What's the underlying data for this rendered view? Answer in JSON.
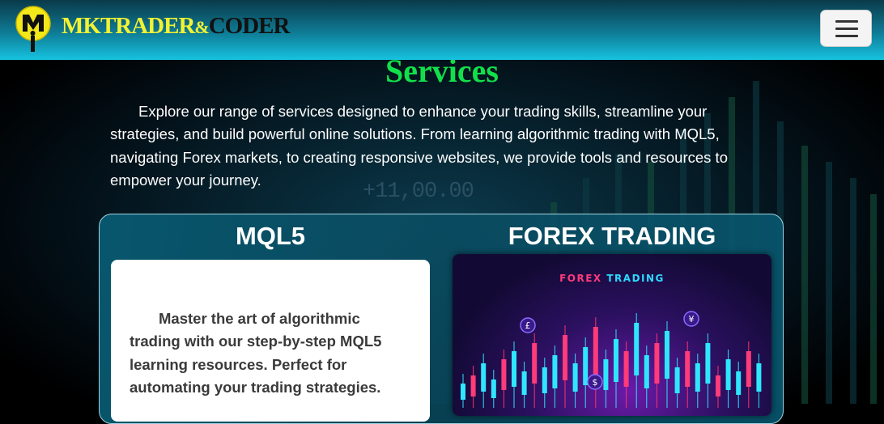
{
  "navbar": {
    "logo_letter": "M",
    "brand_part1": "MK",
    "brand_part2": "TRADER",
    "brand_amp": "&",
    "brand_part3": "CODER",
    "toggler_icon": "hamburger-menu-icon"
  },
  "services": {
    "title": "Services",
    "intro": "Explore our range of services designed to enhance your trading skills, streamline your strategies, and build powerful online solutions. From learning algorithmic trading with MQL5, navigating Forex markets, to creating responsive websites, we provide tools and resources to empower your journey.",
    "background_ticker": "+11,00.00"
  },
  "cards": [
    {
      "title": "MQL5",
      "description": "Master the art of algorithmic trading with our step-by-step MQL5 learning resources. Perfect for automating your trading strategies."
    },
    {
      "title": "FOREX TRADING",
      "image_caption_part1": "FOREX",
      "image_caption_part2": "TRADING"
    }
  ],
  "colors": {
    "title_green": "#12e04a",
    "brand_yellow": "#f2f233",
    "navbar_cyan": "#16c3e0",
    "card_teal": "#0a5c74"
  }
}
